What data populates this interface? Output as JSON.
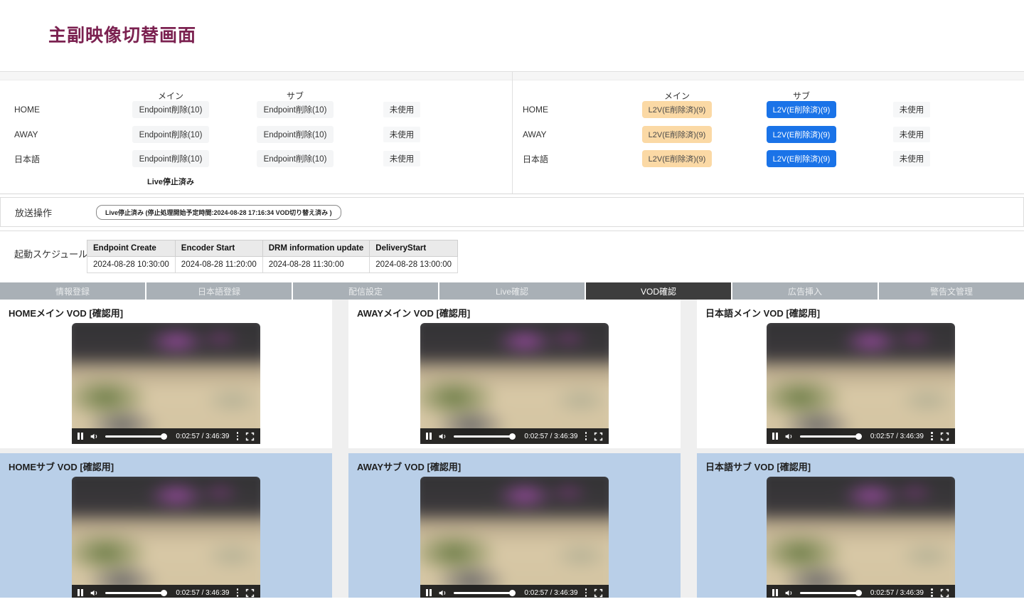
{
  "page": {
    "title": "主副映像切替画面"
  },
  "endpoint_panel": {
    "header_main": "メイン",
    "header_sub": "サブ",
    "rows": [
      {
        "label": "HOME",
        "main": "Endpoint削除(10)",
        "sub": "Endpoint削除(10)",
        "unused": "未使用"
      },
      {
        "label": "AWAY",
        "main": "Endpoint削除(10)",
        "sub": "Endpoint削除(10)",
        "unused": "未使用"
      },
      {
        "label": "日本語",
        "main": "Endpoint削除(10)",
        "sub": "Endpoint削除(10)",
        "unused": "未使用"
      }
    ],
    "status_note": "Live停止済み"
  },
  "l2v_panel": {
    "header_main": "メイン",
    "header_sub": "サブ",
    "rows": [
      {
        "label": "HOME",
        "main": "L2V(E削除済)(9)",
        "sub": "L2V(E削除済)(9)",
        "unused": "未使用"
      },
      {
        "label": "AWAY",
        "main": "L2V(E削除済)(9)",
        "sub": "L2V(E削除済)(9)",
        "unused": "未使用"
      },
      {
        "label": "日本語",
        "main": "L2V(E削除済)(9)",
        "sub": "L2V(E削除済)(9)",
        "unused": "未使用"
      }
    ]
  },
  "broadcast_controls": {
    "label": "放送操作",
    "stop_button": "Live停止済み (停止処理開始予定時間:2024-08-28 17:16:34 VOD切り替え済み )"
  },
  "startup_schedule": {
    "label": "起動スケジュール",
    "headers": [
      "Endpoint Create",
      "Encoder Start",
      "DRM information update",
      "DeliveryStart"
    ],
    "values": [
      "2024-08-28 10:30:00",
      "2024-08-28 11:20:00",
      "2024-08-28 11:30:00",
      "2024-08-28 13:00:00"
    ]
  },
  "tabs": {
    "items": [
      "情報登録",
      "日本語登録",
      "配信設定",
      "Live確認",
      "VOD確認",
      "広告挿入",
      "警告文管理"
    ],
    "active": "VOD確認"
  },
  "video_panels": {
    "time_display": "0:02:57 / 3:46:39",
    "panels": [
      {
        "title": "HOMEメイン VOD [確認用]"
      },
      {
        "title": "AWAYメイン VOD [確認用]"
      },
      {
        "title": "日本語メイン VOD [確認用]"
      },
      {
        "title": "HOMEサブ VOD [確認用]"
      },
      {
        "title": "AWAYサブ VOD [確認用]"
      },
      {
        "title": "日本語サブ VOD [確認用]"
      }
    ]
  },
  "icons": {
    "pause": "pause-icon",
    "volume": "volume-icon",
    "overflow": "kebab-menu-icon",
    "fullscreen": "fullscreen-icon"
  },
  "colors": {
    "title_accent": "#7b2150",
    "button_orange": "#fbd9a5",
    "button_blue": "#1a73e8",
    "button_gray": "#f4f5f6",
    "tab_inactive": "#a9b0b6",
    "tab_active": "#3d3d3d",
    "sub_panel_blue": "#b9cfe8"
  }
}
